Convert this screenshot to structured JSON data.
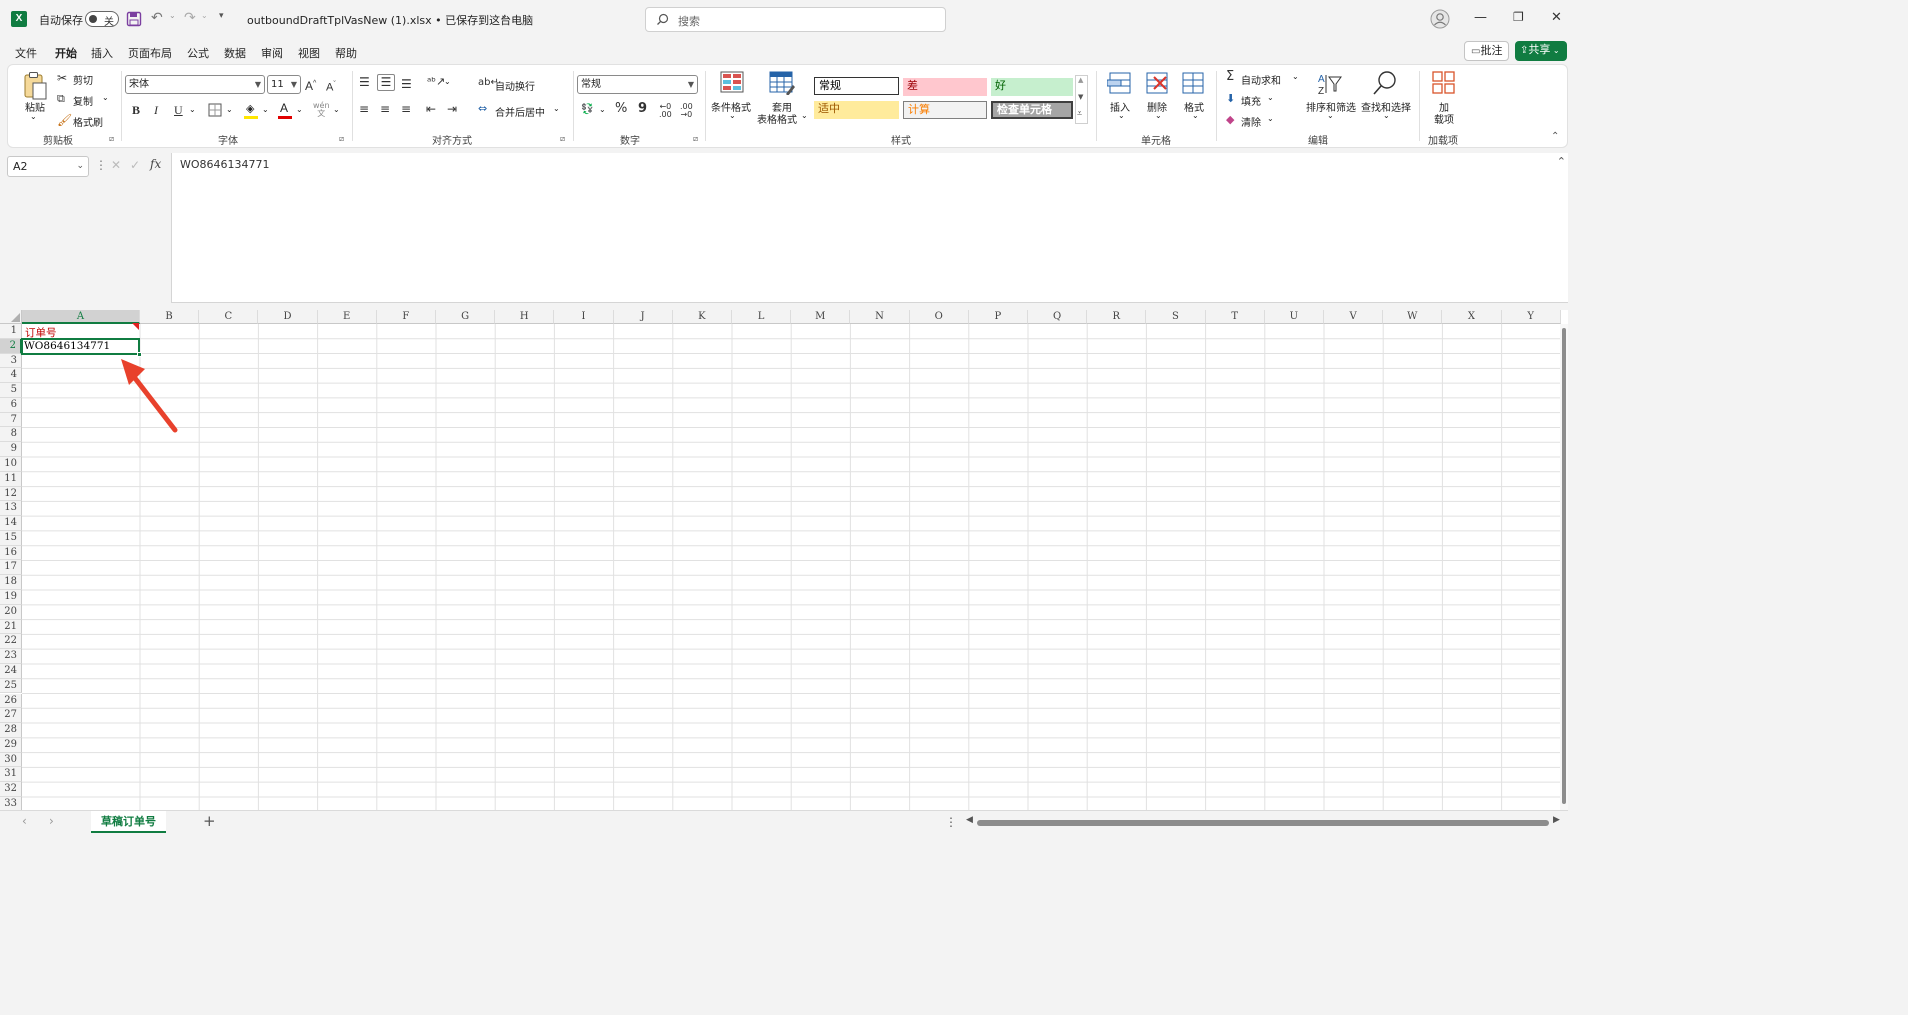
{
  "app": {
    "icon_letter": "X"
  },
  "titlebar": {
    "autosave_label": "自动保存",
    "autosave_state": "关",
    "filename": "outboundDraftTplVasNew (1).xlsx • 已保存到这台电脑",
    "search_placeholder": "搜索"
  },
  "menu": {
    "items": [
      "文件",
      "开始",
      "插入",
      "页面布局",
      "公式",
      "数据",
      "审阅",
      "视图",
      "帮助"
    ],
    "active_index": 1,
    "comments_label": "批注",
    "share_label": "共享"
  },
  "ribbon": {
    "clipboard": {
      "paste": "粘贴",
      "cut": "剪切",
      "copy": "复制",
      "format_painter": "格式刷",
      "group": "剪贴板"
    },
    "font": {
      "name": "宋体",
      "size": "11",
      "bold": "B",
      "italic": "I",
      "underline": "U",
      "group": "字体"
    },
    "alignment": {
      "wrap_text": "自动换行",
      "merge_center": "合并后居中",
      "group": "对齐方式"
    },
    "number": {
      "format": "常规",
      "percent": "%",
      "comma": "9",
      "group": "数字"
    },
    "styles": {
      "conditional_format": "条件格式",
      "format_table_1": "套用",
      "format_table_2": "表格格式",
      "normal": "常规",
      "bad": "差",
      "good": "好",
      "neutral": "适中",
      "calculation": "计算",
      "check_cell": "检查单元格",
      "group": "样式"
    },
    "cells": {
      "insert": "插入",
      "delete": "删除",
      "format": "格式",
      "group": "单元格"
    },
    "editing": {
      "autosum": "自动求和",
      "fill": "填充",
      "clear": "清除",
      "sort_filter": "排序和筛选",
      "find_select": "查找和选择",
      "group": "编辑"
    },
    "addins": {
      "label_1": "加",
      "label_2": "载项",
      "group": "加载项"
    }
  },
  "formula_bar": {
    "name_box": "A2",
    "fx": "fx",
    "value": "WO8646134771"
  },
  "grid": {
    "columns": [
      "A",
      "B",
      "C",
      "D",
      "E",
      "F",
      "G",
      "H",
      "I",
      "J",
      "K",
      "L",
      "M",
      "N",
      "O",
      "P",
      "Q",
      "R",
      "S",
      "T",
      "U",
      "V",
      "W",
      "X",
      "Y"
    ],
    "row_count": 33,
    "selected_cell": "A2",
    "cells": {
      "A1": "订单号",
      "A2": "WO8646134771"
    }
  },
  "sheets": {
    "tabs": [
      "草稿订单号"
    ],
    "active": "草稿订单号"
  },
  "colors": {
    "accent": "#107c41",
    "header_text": "#c00000",
    "annotation_arrow": "#e8412c"
  }
}
